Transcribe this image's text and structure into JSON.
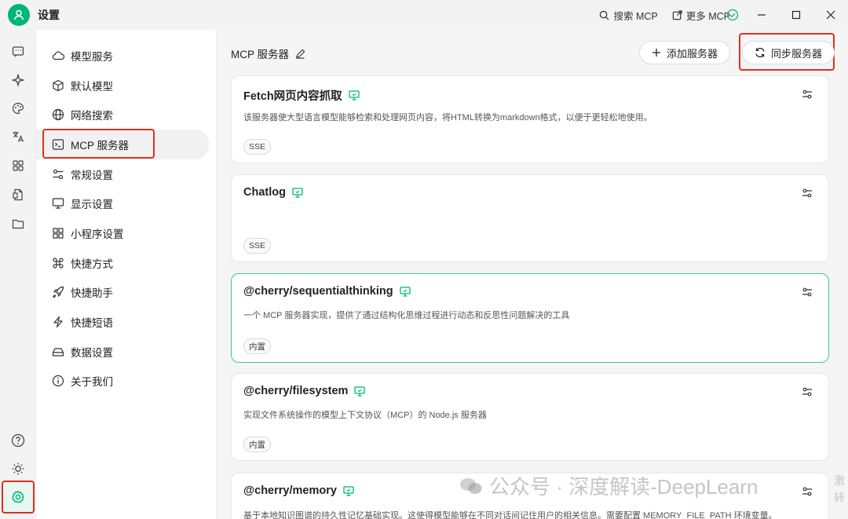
{
  "app": {
    "title": "设置"
  },
  "titlebar": {
    "search_mcp": "搜索 MCP",
    "more_mcp": "更多 MCP"
  },
  "rail": {
    "icons": [
      "chat-icon",
      "sparkle-icon",
      "palette-icon",
      "translate-icon",
      "apps-icon",
      "files-icon",
      "folder-icon",
      "help-icon",
      "theme-icon",
      "settings-icon"
    ]
  },
  "nav": {
    "items": [
      {
        "label": "模型服务",
        "icon": "cloud-icon"
      },
      {
        "label": "默认模型",
        "icon": "cube-icon"
      },
      {
        "label": "网络搜索",
        "icon": "globe-icon"
      },
      {
        "label": "MCP 服务器",
        "icon": "terminal-icon"
      },
      {
        "label": "常规设置",
        "icon": "sliders-icon"
      },
      {
        "label": "显示设置",
        "icon": "monitor-icon"
      },
      {
        "label": "小程序设置",
        "icon": "grid-icon"
      },
      {
        "label": "快捷方式",
        "icon": "command-icon"
      },
      {
        "label": "快捷助手",
        "icon": "rocket-icon"
      },
      {
        "label": "快捷短语",
        "icon": "bolt-icon"
      },
      {
        "label": "数据设置",
        "icon": "drive-icon"
      },
      {
        "label": "关于我们",
        "icon": "info-icon"
      }
    ]
  },
  "main": {
    "title": "MCP 服务器",
    "add_label": "添加服务器",
    "sync_label": "同步服务器",
    "cards": [
      {
        "title": "Fetch网页内容抓取",
        "desc": "该服务器使大型语言模型能够检索和处理网页内容，将HTML转换为markdown格式，以便于更轻松地使用。",
        "tag": "SSE"
      },
      {
        "title": "Chatlog",
        "desc": "",
        "tag": "SSE"
      },
      {
        "title": "@cherry/sequentialthinking",
        "desc": "一个 MCP 服务器实现，提供了通过结构化思维过程进行动态和反思性问题解决的工具",
        "tag": "内置"
      },
      {
        "title": "@cherry/filesystem",
        "desc": "实现文件系统操作的模型上下文协议（MCP）的 Node.js 服务器",
        "tag": "内置"
      },
      {
        "title": "@cherry/memory",
        "desc": "基于本地知识图谱的持久性记忆基础实现。这使得模型能够在不同对话间记住用户的相关信息。需要配置 MEMORY_FILE_PATH 环境变量。",
        "tag": ""
      }
    ]
  },
  "watermark": {
    "text": "公众号 · 深度解读-DeepLearn",
    "side": "激转"
  },
  "colors": {
    "accent": "#00b578",
    "highlight": "#e0301e",
    "active_border": "#45c48f"
  }
}
